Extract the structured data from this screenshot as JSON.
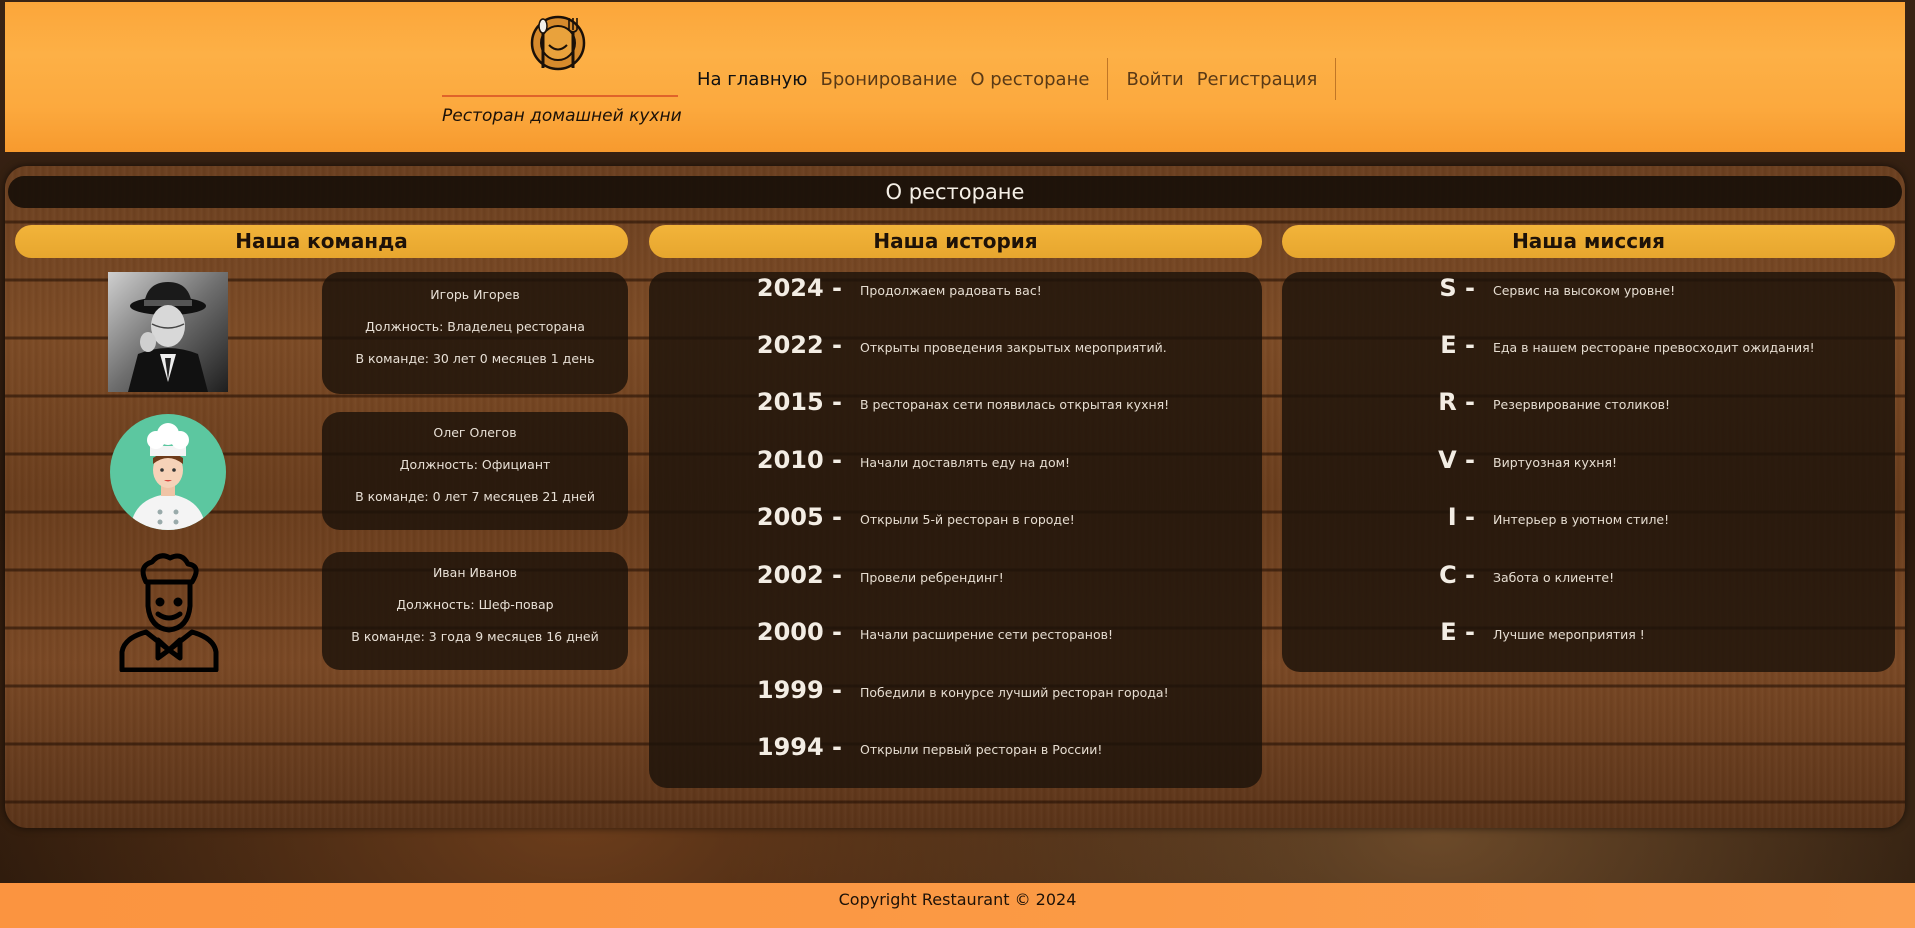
{
  "brand": {
    "tagline": "Ресторан домашней кухни",
    "accent": "#e0632a"
  },
  "nav": {
    "items": [
      "На главную",
      "Бронирование",
      "О ресторане"
    ],
    "auth": [
      "Войти",
      "Регистрация"
    ],
    "active": "На главную"
  },
  "page": {
    "title": "О ресторане"
  },
  "team": {
    "heading": "Наша команда",
    "members": [
      {
        "name": "Игорь Игорев",
        "role": "Должность: Владелец ресторана",
        "tenure": "В команде: 30 лет 0 месяцев 1 день",
        "photo": "man-in-hat-portrait"
      },
      {
        "name": "Олег Олегов",
        "role": "Должность: Официант",
        "tenure": "В команде: 0 лет 7 месяцев 21 дней",
        "photo": "chef-avatar-icon"
      },
      {
        "name": "Иван Иванов",
        "role": "Должность: Шеф-повар",
        "tenure": "В команде: 3 года 9 месяцев 16 дней",
        "photo": "chef-outline-icon"
      }
    ]
  },
  "history": {
    "heading": "Наша история",
    "events": [
      {
        "year": "2024 -",
        "text": "Продолжаем радовать вас!"
      },
      {
        "year": "2022 -",
        "text": "Открыты проведения закрытых мероприятий."
      },
      {
        "year": "2015 -",
        "text": "В ресторанах сети появилась открытая кухня!"
      },
      {
        "year": "2010 -",
        "text": "Начали доставлять еду на дом!"
      },
      {
        "year": "2005 -",
        "text": "Открыли 5-й ресторан в городе!"
      },
      {
        "year": "2002 -",
        "text": "Провели ребрендинг!"
      },
      {
        "year": "2000 -",
        "text": "Начали расширение сети ресторанов!"
      },
      {
        "year": "1999 -",
        "text": "Победили в конурсе лучший ресторан города!"
      },
      {
        "year": "1994 -",
        "text": "Открыли первый ресторан в России!"
      }
    ]
  },
  "mission": {
    "heading": "Наша миссия",
    "items": [
      {
        "letter": "S -",
        "text": "Сервис на высоком уровне!"
      },
      {
        "letter": "E -",
        "text": "Еда в нашем ресторане превосходит ожидания!"
      },
      {
        "letter": "R -",
        "text": "Резервирование столиков!"
      },
      {
        "letter": "V -",
        "text": "Виртуозная кухня!"
      },
      {
        "letter": "I -",
        "text": "Интерьер в уютном стиле!"
      },
      {
        "letter": "C -",
        "text": "Забота о клиенте!"
      },
      {
        "letter": "E -",
        "text": "Лучшие мероприятия !"
      }
    ]
  },
  "footer": {
    "copyright": "Copyright Restaurant © 2024"
  },
  "colors": {
    "header": "#fca63a",
    "column_heading": "#f2b43a",
    "card": "#1c120a",
    "footer": "#fb9440"
  }
}
